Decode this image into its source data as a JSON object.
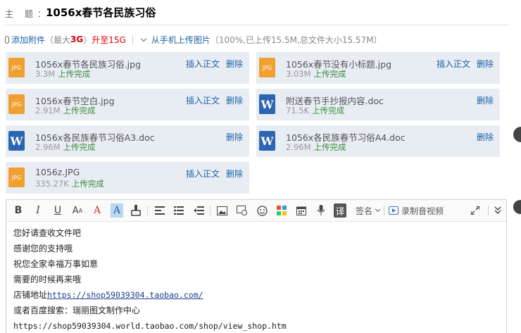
{
  "subject": {
    "label": "主 题：",
    "value": "1056x春节各民族习俗"
  },
  "attach_bar": {
    "add_attachment": "添加附件",
    "max_prefix": "（最大",
    "max_value": "3G",
    "max_suffix": "）",
    "upgrade": "升至15G",
    "mobile_upload": "从手机上传图片",
    "progress_text": "（100%,已上传15.5M,总文件大小15.57M）"
  },
  "files": [
    {
      "name": "1056x春节各民族习俗.jpg",
      "size": "3.3M",
      "status": "上传完成",
      "type": "JPG",
      "insert": "插入正文",
      "delete": "删除"
    },
    {
      "name": "1056x春节没有小标题.jpg",
      "size": "3.03M",
      "status": "上传完成",
      "type": "JPG",
      "insert": "插入正文",
      "delete": "删除"
    },
    {
      "name": "1056x春节空白.jpg",
      "size": "2.91M",
      "status": "上传完成",
      "type": "JPG",
      "insert": "插入正文",
      "delete": "删除"
    },
    {
      "name": "附送春节手抄报内容.doc",
      "size": "71.5K",
      "status": "上传完成",
      "type": "W",
      "insert": "",
      "delete": "删除"
    },
    {
      "name": "1056x各民族春节习俗A3.doc",
      "size": "2.96M",
      "status": "上传完成",
      "type": "W",
      "insert": "",
      "delete": "删除"
    },
    {
      "name": "1056x各民族春节习俗A4.doc",
      "size": "2.96M",
      "status": "上传完成",
      "type": "W",
      "insert": "",
      "delete": "删除"
    },
    {
      "name": "1056z.JPG",
      "size": "335.27K",
      "status": "上传完成",
      "type": "JPG",
      "insert": "插入正文",
      "delete": "删除"
    }
  ],
  "toolbar": {
    "signature": "签名",
    "record_video": "录制音视频"
  },
  "body_lines": [
    "您好请查收文件吧",
    "感谢您的支持哦",
    "祝您全家幸福万事如意",
    "需要的时候再来哦"
  ],
  "shop_prefix": "店铺地址",
  "shop_url": "https://shop59039304.taobao.com/",
  "baidu_line": "或者百度搜索：瑞丽图文制作中心",
  "world_url": "https://shop59039304.world.taobao.com/shop/view_shop.htm",
  "colors": {
    "link": "#1a62a8",
    "card_bg": "#e8ecf3",
    "jpg_icon": "#f0a030",
    "doc_icon": "#2b65b3",
    "ok_green": "#3a8d3a",
    "warn_red": "#dd0000"
  }
}
